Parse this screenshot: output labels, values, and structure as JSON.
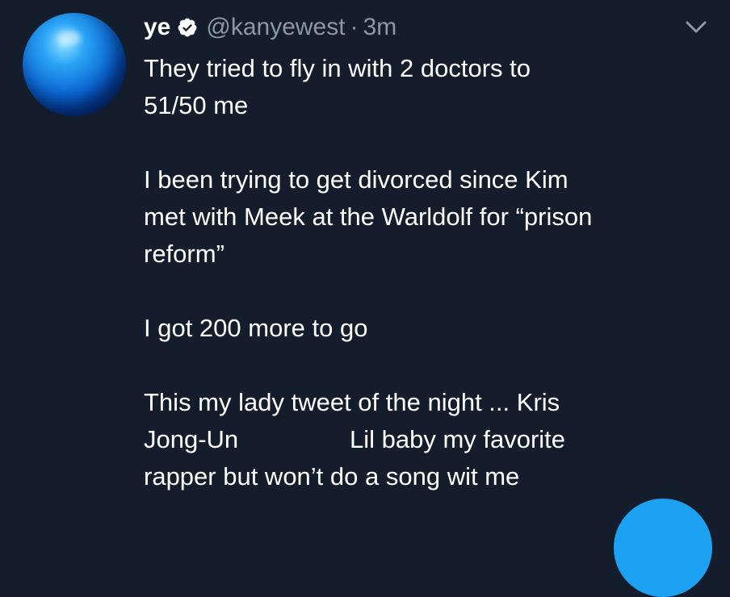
{
  "tweet": {
    "display_name": "ye",
    "handle": "@kanyewest",
    "separator": "·",
    "time": "3m",
    "paragraphs": [
      "They tried to fly in with 2 doctors to\n51/50 me",
      "I been trying to get divorced since Kim\nmet with Meek at the Warldolf for “prison\nreform”",
      "I got 200 more to go",
      "This my lady tweet of the night ... Kris\nJong-Un                Lil baby my favorite\nrapper but won’t do a song wit me"
    ]
  },
  "icons": {
    "verified": "verified-badge-icon",
    "menu": "chevron-down-icon",
    "compose": "compose-fab"
  },
  "colors": {
    "background": "#141d2b",
    "text": "#ffffff",
    "muted": "#8b98a5",
    "accent": "#1da1f2"
  }
}
